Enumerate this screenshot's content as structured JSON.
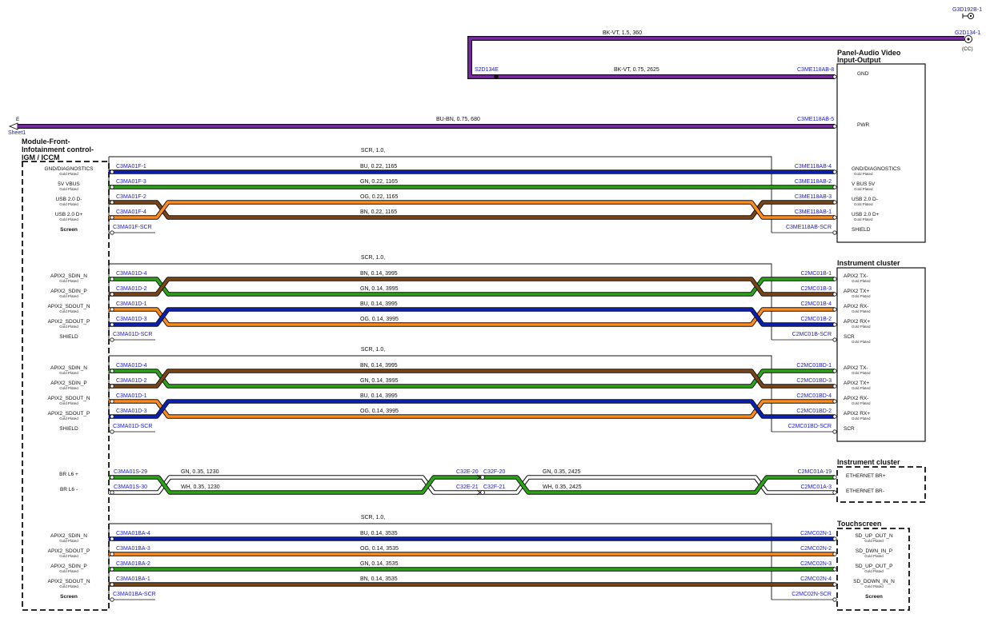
{
  "module": {
    "title": [
      "Module-Front-",
      "Infotainment control-",
      "IGM / ICCM"
    ],
    "plating": "Gold Plated",
    "groups": [
      {
        "labels": [
          "GND/DIAGNOSTICS",
          "5V VBUS",
          "USB 2.0 D-",
          "USB 2.0 D+",
          "Screen"
        ],
        "plated": [
          true,
          true,
          true,
          true,
          false
        ]
      },
      {
        "labels": [
          "APIX2_SDIN_N",
          "APIX2_SDIN_P",
          "APIX2_SDOUT_N",
          "APIX2_SDOUT_P",
          "SHIELD"
        ],
        "plated": [
          true,
          true,
          true,
          true,
          false
        ]
      },
      {
        "labels": [
          "APIX2_SDIN_N",
          "APIX2_SDIN_P",
          "APIX2_SDOUT_N",
          "APIX2_SDOUT_P",
          "SHIELD"
        ],
        "plated": [
          true,
          true,
          true,
          true,
          false
        ]
      },
      {
        "labels": [
          "BR L6 +",
          "BR L6 -"
        ],
        "plated": [
          false,
          false
        ]
      },
      {
        "labels": [
          "APIX2_SDIN_N",
          "APIX2_SDOUT_P",
          "APIX2_SDIN_P",
          "APIX2_SDOUT_N",
          "Screen"
        ],
        "plated": [
          true,
          true,
          true,
          true,
          false
        ]
      }
    ]
  },
  "top": {
    "g3": "G3D192B-1",
    "g2": "G2D134-1",
    "cc": "(CC)",
    "wire_top": "BK-VT,  1.5,  360",
    "splice": "S2D134E",
    "wire_mid": "BK-VT,  0.75,  2625",
    "pin_mid": "C3ME118AB-8",
    "sheet_e": "E",
    "sheet": "Sheet1",
    "wire_pwr": "BU-BN,  0.75,  680",
    "pin_pwr": "C3ME118AB-5"
  },
  "panel": {
    "title": [
      "Panel-Audio Video",
      "Input-Output"
    ],
    "gnd": "GND",
    "pwr": "PWR",
    "labels": [
      "GND/DIAGNOSTICS",
      "V BUS 5V",
      "USB 2.0 D-",
      "USB 2.0 D+",
      "SHIELD"
    ],
    "plated": [
      true,
      true,
      true,
      true,
      false
    ]
  },
  "cluster1": {
    "title": "Instrument cluster",
    "labels": [
      "APIX2 TX-",
      "APIX2 TX+",
      "APIX2 RX-",
      "APIX2 RX+",
      "SCR",
      "APIX2 TX-",
      "APIX2 TX+",
      "APIX2 RX-",
      "APIX2 RX+",
      "SCR"
    ],
    "plated": [
      true,
      true,
      true,
      true,
      true,
      true,
      true,
      true,
      true,
      false
    ]
  },
  "cluster2": {
    "title": "Instrument cluster",
    "labels": [
      "ETHERNET BR+",
      "ETHERNET BR-"
    ]
  },
  "touch": {
    "title": "Touchscreen",
    "labels": [
      "SD_UP_OUT_N",
      "SD_DWN_IN_P",
      "SD_UP_OUT_P",
      "SD_DOWN_IN_N",
      "Screen"
    ],
    "plated": [
      true,
      true,
      true,
      true,
      false
    ]
  },
  "cables": [
    {
      "scr": "SCR,  1.0,",
      "left_shield": "C3MA01F-SCR",
      "right_shield": "C3ME118AB-SCR",
      "wires": [
        {
          "left": "C3MA01F-1",
          "right": "C3ME118AB-4",
          "label": "BU,  0.22,  1165",
          "color": "#0a1fb5"
        },
        {
          "left": "C3MA01F-3",
          "right": "C3ME118AB-2",
          "label": "GN,  0.22,  1165",
          "color": "#2aa317"
        },
        {
          "left": "C3MA01F-2",
          "right": "C3ME118AB-3",
          "label": "BN,  0.22,  1165",
          "color": "#7a4516"
        },
        {
          "left": "C3MA01F-4",
          "right": "C3ME118AB-1",
          "label": "OG,  0.22,  1165",
          "color": "#ff8a1c"
        }
      ]
    },
    {
      "scr": "SCR,  1.0,",
      "left_shield": "C3MA01D-SCR",
      "right_shield": "C2MC01B-SCR",
      "wires": [
        {
          "left": "C3MA01D-4",
          "right": "C2MC01B-1",
          "label": "GN,  0.14,  3995",
          "color": "#2aa317"
        },
        {
          "left": "C3MA01D-2",
          "right": "C2MC01B-3",
          "label": "BN,  0.14,  3995",
          "color": "#7a4516"
        },
        {
          "left": "C3MA01D-1",
          "right": "C2MC01B-4",
          "label": "OG,  0.14,  3995",
          "color": "#ff8a1c"
        },
        {
          "left": "C3MA01D-3",
          "right": "C2MC01B-2",
          "label": "BU,  0.14,  3995",
          "color": "#0a1fb5"
        }
      ]
    },
    {
      "scr": "SCR,  1.0,",
      "left_shield": "C3MA01D-SCR",
      "right_shield": "C2MC01BD-SCR",
      "wires": [
        {
          "left": "C3MA01D-4",
          "right": "C2MC01BD-1",
          "label": "GN,  0.14,  3995",
          "color": "#2aa317"
        },
        {
          "left": "C3MA01D-2",
          "right": "C2MC01BD-3",
          "label": "BN,  0.14,  3995",
          "color": "#7a4516"
        },
        {
          "left": "C3MA01D-1",
          "right": "C2MC01BD-4",
          "label": "OG,  0.14,  3995",
          "color": "#ff8a1c"
        },
        {
          "left": "C3MA01D-3",
          "right": "C2MC01BD-2",
          "label": "BU,  0.14,  3995",
          "color": "#0a1fb5"
        }
      ]
    },
    {
      "scr": "SCR,  1.0,",
      "left_shield": "C3MA01BA-SCR",
      "right_shield": "C2MC02N-SCR",
      "wires": [
        {
          "left": "C3MA01BA-4",
          "right": "C2MC02N-1",
          "label": "BU,  0.14,  3535",
          "color": "#0a1fb5"
        },
        {
          "left": "C3MA01BA-3",
          "right": "C2MC02N-2",
          "label": "OG,  0.14,  3535",
          "color": "#ff8a1c"
        },
        {
          "left": "C3MA01BA-2",
          "right": "C2MC02N-3",
          "label": "GN,  0.14,  3535",
          "color": "#2aa317"
        },
        {
          "left": "C3MA01BA-1",
          "right": "C2MC02N-4",
          "label": "BN,  0.14,  3535",
          "color": "#7a4516"
        }
      ]
    }
  ],
  "ethernet": {
    "green": {
      "left": "C3MA01S-29",
      "right": "C2MC01A-19",
      "mid_left": "C32E-20",
      "mid_right": "C32F-20",
      "label_left": "GN,  0.35,  1230",
      "label_right": "GN,  0.35,  2425",
      "color": "#2aa317"
    },
    "white": {
      "left": "C3MA01S-30",
      "right": "C2MC01A-3",
      "mid_left": "C32E-21",
      "mid_right": "C32F-21",
      "label_left": "WH,  0.35,  1230",
      "label_right": "WH,  0.35,  2425"
    }
  },
  "colors": {
    "blue": "#0a1fb5",
    "green": "#2aa317",
    "brown": "#7a4516",
    "orange": "#ff8a1c",
    "violet": "#7a2aa8",
    "pin_text": "#1a1acc",
    "black": "#111111"
  }
}
